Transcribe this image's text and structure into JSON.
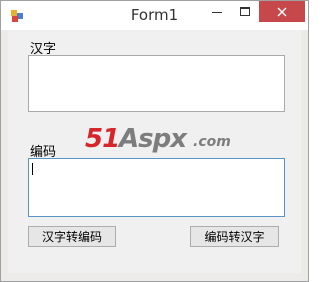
{
  "window": {
    "title": "Form1",
    "icon": "winforms-app-icon",
    "controls": {
      "minimize": "minimize-icon",
      "maximize": "maximize-icon",
      "close": "close-icon",
      "close_color": "#c7484a"
    }
  },
  "form": {
    "hanzi_label": "汉字",
    "hanzi_value": "",
    "code_label": "编码",
    "code_value": "",
    "to_code_button": "汉字转编码",
    "to_hanzi_button": "编码转汉字"
  },
  "watermark": {
    "num": "51",
    "word": "Aspx",
    "tld": ".com",
    "num_color": "#d7262b",
    "word_color": "#7d7d7d"
  }
}
